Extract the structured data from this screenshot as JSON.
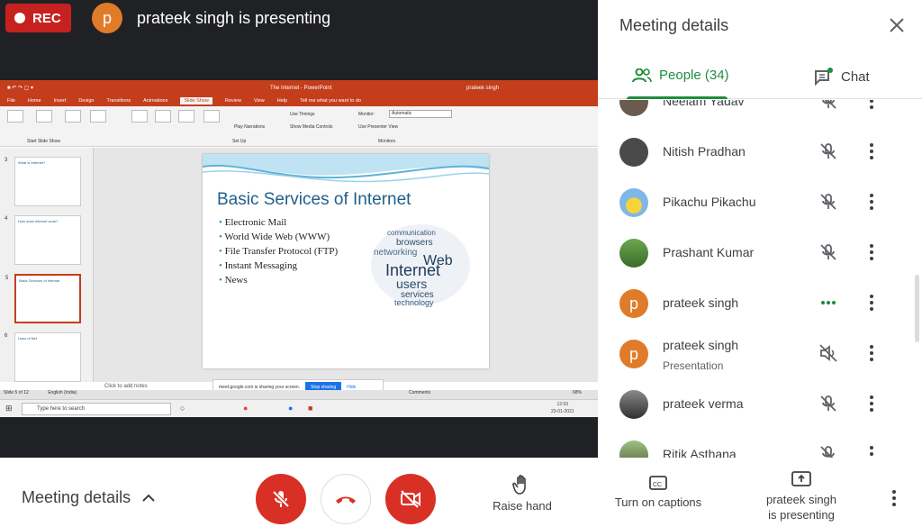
{
  "topbar": {
    "rec_label": "REC",
    "presenter_initial": "p",
    "presenting_text": "prateek singh is presenting"
  },
  "shared_screen": {
    "window_title": "The Internet - PowerPoint",
    "user_name": "prateek singh",
    "tabs": [
      "File",
      "Home",
      "Insert",
      "Design",
      "Transitions",
      "Animations",
      "Slide Show",
      "Review",
      "View",
      "Help",
      "Tell me what you want to do"
    ],
    "active_tab": "Slide Show",
    "ribbon_groups": [
      "Start Slide Show",
      "Set Up",
      "Monitors"
    ],
    "ribbon_options": [
      "Use Timings",
      "Play Narrations",
      "Show Media Controls",
      "Use Presenter View"
    ],
    "monitor_label": "Monitor:",
    "monitor_value": "Automatic",
    "slide": {
      "title": "Basic Services of Internet",
      "bullets": [
        "Electronic Mail",
        "World Wide Web (WWW)",
        "File Transfer Protocol (FTP)",
        "Instant Messaging",
        "News"
      ],
      "cloud_words": [
        "communication",
        "browsers",
        "networking",
        "Web",
        "Internet",
        "users",
        "services",
        "technology"
      ]
    },
    "thumbnails": [
      {
        "num": "3",
        "title": "What is Internet?"
      },
      {
        "num": "4",
        "title": "How does Internet work?"
      },
      {
        "num": "5",
        "title": "Basic Services of Internet"
      },
      {
        "num": "6",
        "title": "Uses of Net"
      }
    ],
    "notes_placeholder": "Click to add notes",
    "status_left": "Slide 5 of 12",
    "status_lang": "English (India)",
    "status_comments": "Comments",
    "zoom": "68%",
    "share_notice": "meet.google.com is sharing your screen.",
    "stop_sharing": "Stop sharing",
    "hide": "Hide",
    "taskbar_search": "Type here to search",
    "clock_time": "12:03",
    "clock_date": "23-01-2021"
  },
  "panel": {
    "title": "Meeting details",
    "tab_people": "People (34)",
    "tab_chat": "Chat",
    "participants": [
      {
        "name": "Neelam Yadav",
        "sub": "",
        "avatar": "photo",
        "mic": "muted"
      },
      {
        "name": "Nitish Pradhan",
        "sub": "",
        "avatar": "photo",
        "mic": "muted"
      },
      {
        "name": "Pikachu Pikachu",
        "sub": "",
        "avatar": "photo",
        "mic": "muted"
      },
      {
        "name": "Prashant Kumar",
        "sub": "",
        "avatar": "photo",
        "mic": "muted"
      },
      {
        "name": "prateek singh",
        "sub": "",
        "avatar": "p",
        "mic": "speaking"
      },
      {
        "name": "prateek singh",
        "sub": "Presentation",
        "avatar": "p",
        "mic": "sound-off"
      },
      {
        "name": "prateek verma",
        "sub": "",
        "avatar": "photo",
        "mic": "muted"
      },
      {
        "name": "Ritik Asthana",
        "sub": "",
        "avatar": "photo",
        "mic": "muted"
      }
    ]
  },
  "bottom": {
    "meeting_details": "Meeting details",
    "raise_hand": "Raise hand",
    "captions": "Turn on captions",
    "presenting_line1": "prateek singh",
    "presenting_line2": "is presenting"
  },
  "colors": {
    "accent_green": "#1e8e3e",
    "danger_red": "#d93025",
    "rec_red": "#c5221f",
    "ppt_orange": "#c43e1c",
    "avatar_orange": "#e07b2a"
  }
}
